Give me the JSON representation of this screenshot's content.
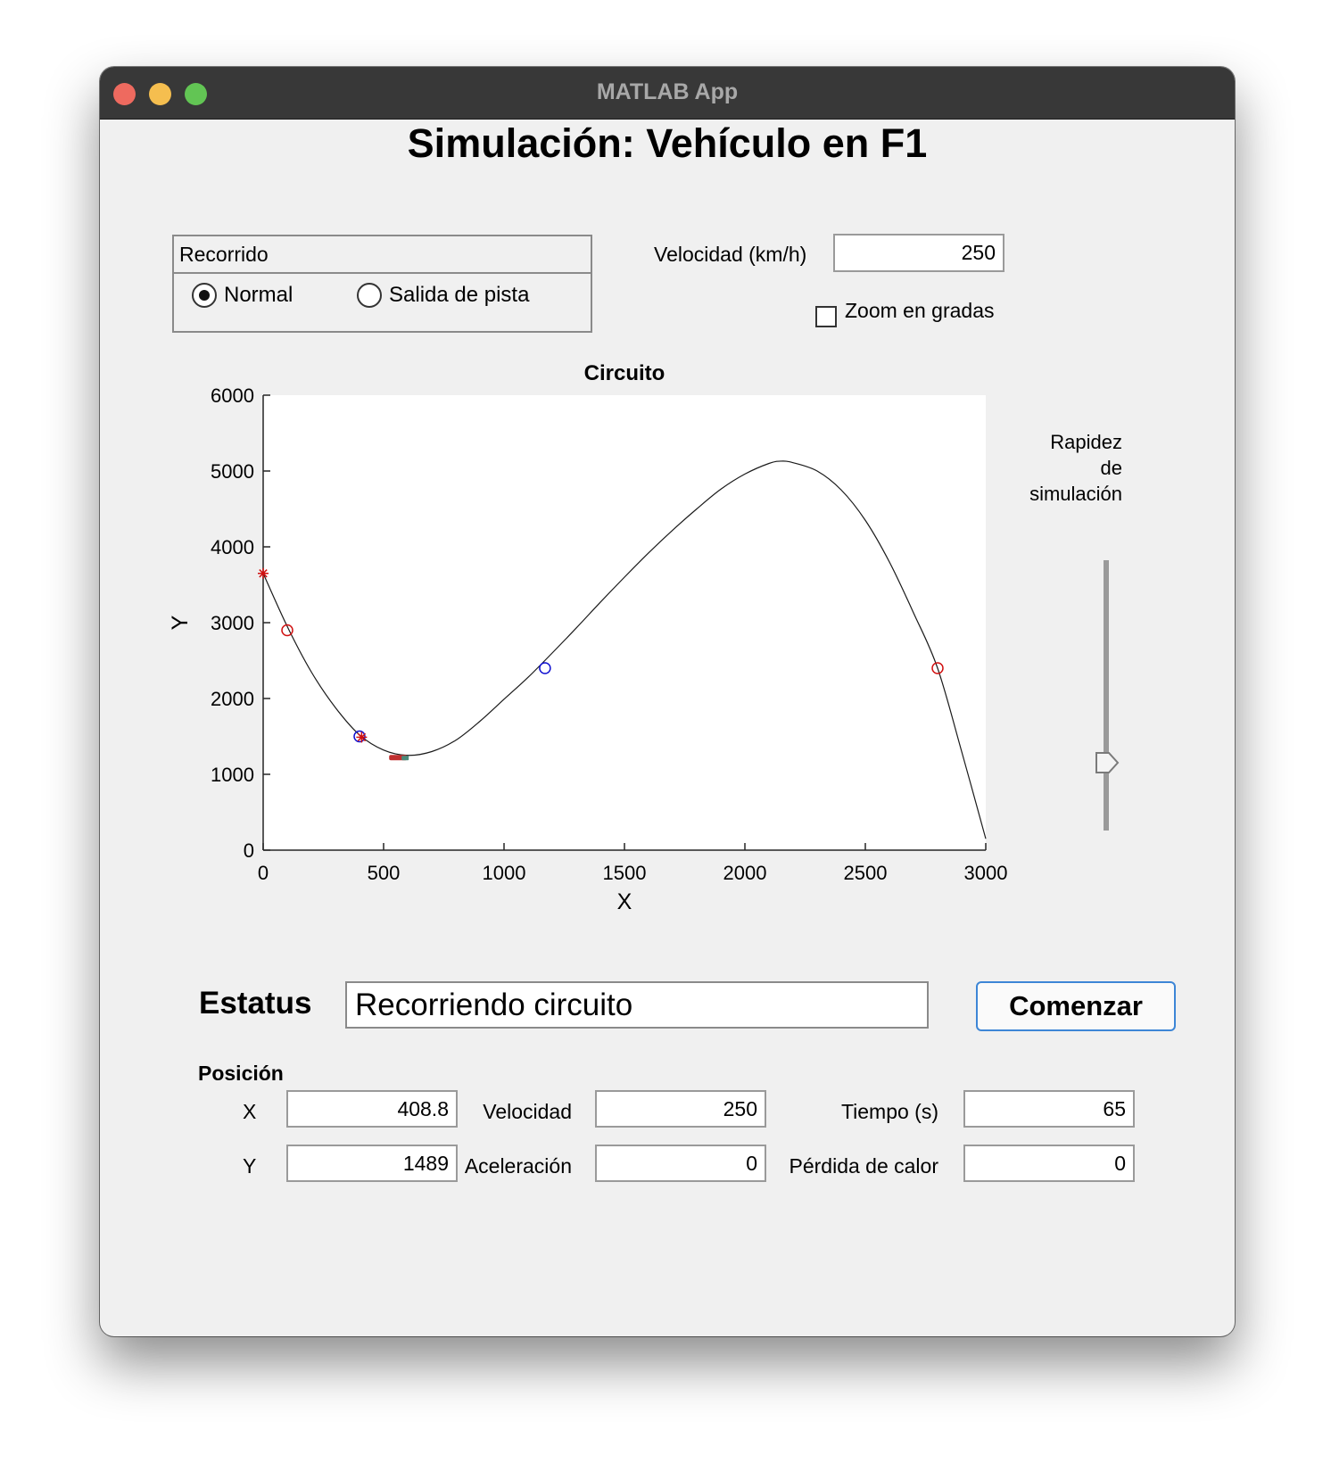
{
  "window": {
    "title": "MATLAB App"
  },
  "app": {
    "title": "Simulación: Vehículo en F1"
  },
  "recorrido": {
    "title": "Recorrido",
    "options": [
      {
        "label": "Normal",
        "selected": true
      },
      {
        "label": "Salida de pista",
        "selected": false
      }
    ]
  },
  "velocidad_input": {
    "label": "Velocidad (km/h)",
    "value": "250"
  },
  "zoom": {
    "label": "Zoom en gradas",
    "checked": false
  },
  "slider": {
    "label_line1": "Rapidez",
    "label_line2": "de",
    "label_line3": "simulación",
    "level": 0.25
  },
  "chart_data": {
    "type": "line",
    "title": "Circuito",
    "xlabel": "X",
    "ylabel": "Y",
    "xlim": [
      0,
      3000
    ],
    "ylim": [
      0,
      6000
    ],
    "xticks": [
      0,
      500,
      1000,
      1500,
      2000,
      2500,
      3000
    ],
    "yticks": [
      0,
      1000,
      2000,
      3000,
      4000,
      5000,
      6000
    ],
    "grid": false,
    "curve": [
      [
        0,
        3650
      ],
      [
        100,
        2950
      ],
      [
        200,
        2350
      ],
      [
        300,
        1880
      ],
      [
        400,
        1520
      ],
      [
        500,
        1320
      ],
      [
        600,
        1250
      ],
      [
        700,
        1300
      ],
      [
        800,
        1450
      ],
      [
        900,
        1700
      ],
      [
        1000,
        1990
      ],
      [
        1100,
        2280
      ],
      [
        1200,
        2600
      ],
      [
        1300,
        2930
      ],
      [
        1400,
        3270
      ],
      [
        1500,
        3600
      ],
      [
        1600,
        3920
      ],
      [
        1700,
        4220
      ],
      [
        1800,
        4500
      ],
      [
        1900,
        4760
      ],
      [
        2000,
        4960
      ],
      [
        2100,
        5100
      ],
      [
        2150,
        5130
      ],
      [
        2200,
        5110
      ],
      [
        2300,
        5000
      ],
      [
        2400,
        4750
      ],
      [
        2500,
        4350
      ],
      [
        2600,
        3800
      ],
      [
        2700,
        3130
      ],
      [
        2800,
        2400
      ],
      [
        2900,
        1300
      ],
      [
        3000,
        150
      ]
    ],
    "markers": [
      {
        "x": 0,
        "y": 3650,
        "symbol": "star",
        "color": "#d01010"
      },
      {
        "x": 100,
        "y": 2900,
        "symbol": "circle",
        "color": "#d01010"
      },
      {
        "x": 400,
        "y": 1500,
        "symbol": "circle",
        "color": "#1010d0"
      },
      {
        "x": 408.8,
        "y": 1489,
        "symbol": "star",
        "color": "#d01010"
      },
      {
        "x": 1170,
        "y": 2400,
        "symbol": "circle",
        "color": "#1010d0"
      },
      {
        "x": 2800,
        "y": 2400,
        "symbol": "circle",
        "color": "#d01010"
      }
    ],
    "car": {
      "x": 560,
      "y": 1220
    }
  },
  "status": {
    "label": "Estatus",
    "value": "Recorriendo circuito"
  },
  "start_button": {
    "label": "Comenzar"
  },
  "readouts": {
    "section_label": "Posición",
    "x": {
      "label": "X",
      "value": "408.8"
    },
    "y": {
      "label": "Y",
      "value": "1489"
    },
    "velocidad": {
      "label": "Velocidad",
      "value": "250"
    },
    "aceleracion": {
      "label": "Aceleración",
      "value": "0"
    },
    "tiempo": {
      "label": "Tiempo (s)",
      "value": "65"
    },
    "perdida": {
      "label": "Pérdida de calor",
      "value": "0"
    }
  },
  "colors": {
    "window_bg": "#f0f0f0",
    "titlebar": "#383838",
    "button_border": "#3d86d6",
    "marker_red": "#d01010",
    "marker_blue": "#1010d0"
  }
}
